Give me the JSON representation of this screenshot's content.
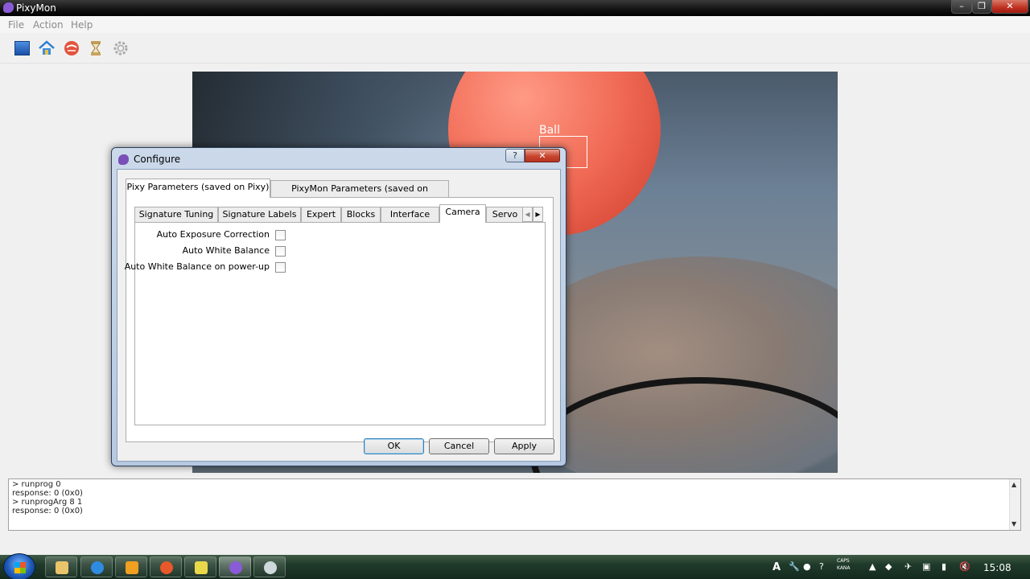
{
  "window": {
    "title": "PixyMon",
    "minimize": "–",
    "maximize": "❐",
    "close": "✕"
  },
  "menu": {
    "file": "File",
    "action": "Action",
    "help": "Help"
  },
  "toolbar": {
    "icons": [
      "run-icon",
      "home-icon",
      "raw-video-icon",
      "default-program-icon",
      "configure-icon"
    ]
  },
  "video": {
    "object_label": "Ball"
  },
  "console": {
    "lines": [
      "> runprog 0",
      "response: 0 (0x0)",
      "> runprogArg 8 1",
      "response: 0 (0x0)"
    ],
    "scroll_up": "▲",
    "scroll_down": "▼"
  },
  "dialog": {
    "title": "Configure",
    "help_button": "?",
    "close_button": "✕",
    "outer_tabs": [
      "Pixy Parameters (saved on Pixy)",
      "PixyMon Parameters (saved on computer)"
    ],
    "inner_tabs": [
      "Signature Tuning",
      "Signature Labels",
      "Expert",
      "Blocks",
      "Interface",
      "Camera",
      "Servo"
    ],
    "active_inner_tab": "Camera",
    "tab_scroll_left": "◀",
    "tab_scroll_right": "▶",
    "settings": [
      {
        "label": "Auto Exposure Correction",
        "checked": false
      },
      {
        "label": "Auto White Balance",
        "checked": false
      },
      {
        "label": "Auto White Balance on power-up",
        "checked": false
      }
    ],
    "buttons": {
      "ok": "OK",
      "cancel": "Cancel",
      "apply": "Apply"
    }
  },
  "taskbar": {
    "apps": [
      "file-explorer",
      "internet-explorer",
      "media-player",
      "firefox",
      "notepad",
      "pixymon",
      "paint"
    ],
    "tray": {
      "ime": "A",
      "caps": "CAPS",
      "kana": "KANA"
    },
    "clock": "15:08"
  },
  "colors": {
    "dialog_border": "#b6c9e1",
    "close_red": "#c8452f",
    "ball": "#f06a55"
  }
}
